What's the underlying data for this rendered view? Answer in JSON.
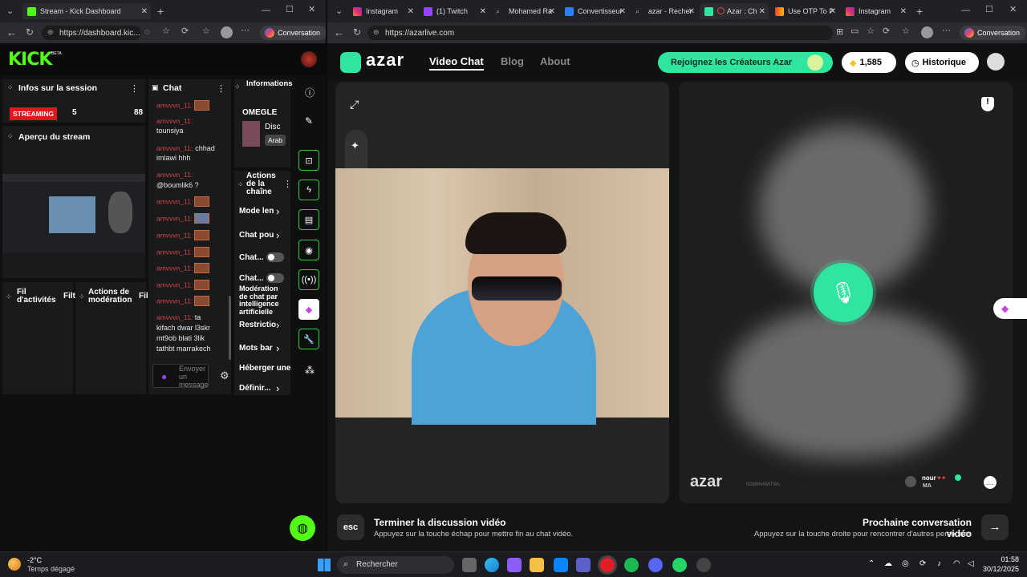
{
  "left_browser": {
    "tab_title": "Stream - Kick Dashboard",
    "url": "https://dashboard.kic...",
    "conversation_btn": "Conversation",
    "logo": "KICK",
    "logo_sup": "BETA",
    "session_title": "Infos sur la session",
    "streaming_badge": "STREAMING",
    "viewers": "5",
    "followers": "88",
    "preview_title": "Aperçu du stream",
    "activity_title": "Fil d'activités",
    "activity_filter": "Filt",
    "moderation_title": "Actions de modération",
    "moderation_filter": "Fil",
    "chat_title": "Chat",
    "chat_user": "amvvvn_11",
    "chat_messages": [
      "tounsiya",
      "chhad imlawi hhh",
      "@boumlik6 ?",
      "ta kifach dwar l3skr mt9ob blati 3lik tathbt marrakech"
    ],
    "chat_placeholder": "Envoyer un message",
    "info_title": "Informations sur le stream",
    "info_category": "OMEGLE",
    "info_line1": "Disc",
    "info_tag": "Arab",
    "actions_title": "Actions de la chaîne",
    "actions": [
      "Mode len",
      "Chat pou",
      "Chat...",
      "Chat...",
      "Modération de chat par intelligence artificielle",
      "Restrictio",
      "Mots bar",
      "Héberger une",
      "Définir..."
    ]
  },
  "right_browser": {
    "tabs": [
      "Instagram",
      "(1) Twitch",
      "Mohamed Ra",
      "Convertisseur",
      "azar - Recher",
      "Azar : Ch",
      "Use OTP To P",
      "Instagram"
    ],
    "url": "https://azarlive.com",
    "conversation_btn": "Conversation",
    "logo": "azar",
    "nav": [
      "Video Chat",
      "Blog",
      "About"
    ],
    "creators_btn": "Rejoignez les Créateurs Azar",
    "gems": "1,585",
    "history_btn": "Historique",
    "watermark": "azar",
    "watermark_id": "9DMMvWATWc",
    "partner_name": "nour",
    "partner_country": "MA",
    "esc_key": "esc",
    "end_title": "Terminer la discussion vidéo",
    "end_sub": "Appuyez sur la touche échap pour mettre fin au chat vidéo.",
    "next_title": "Prochaine conversation vidéo",
    "next_sub": "Appuyez sur la touche droite pour rencontrer d'autres personnes"
  },
  "taskbar": {
    "weather_temp": "-2°C",
    "weather_desc": "Temps dégagé",
    "search_placeholder": "Rechercher",
    "time": "01:58",
    "date": "30/12/2025"
  },
  "colors": {
    "kick_green": "#53fc18",
    "azar_green": "#2ee6a0",
    "streaming_red": "#e0161d"
  }
}
